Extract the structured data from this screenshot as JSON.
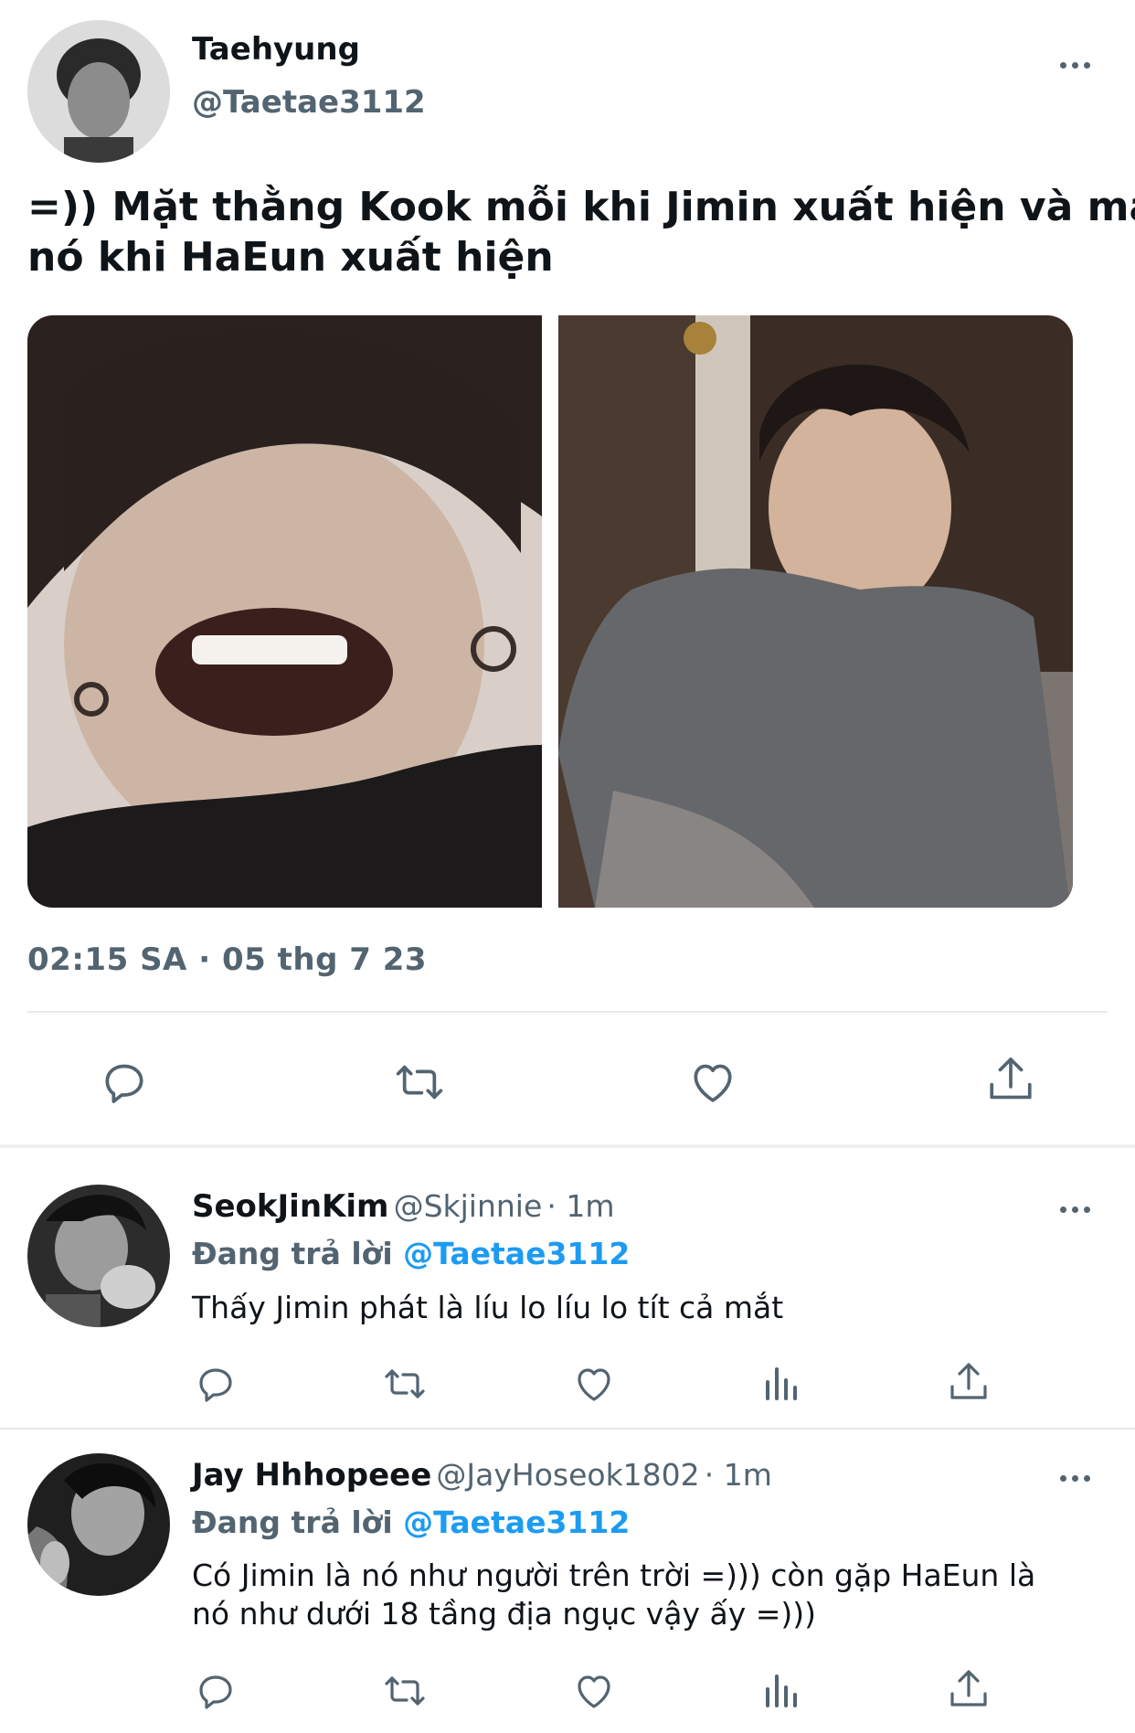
{
  "tweet": {
    "display_name": "Taehyung",
    "handle": "@Taetae3112",
    "text_line1": "=)) Mặt thằng Kook mỗi khi Jimin xuất hiện và mặt",
    "text_line2": "nó khi HaEun xuất hiện",
    "timestamp": "02:15 SA · 05 thg 7 23",
    "more_icon": "more-horizontal-icon"
  },
  "actions": [
    "reply-icon",
    "retweet-icon",
    "like-icon",
    "share-icon"
  ],
  "replies": [
    {
      "display_name": "SeokJinKim",
      "handle": "@Skjinnie",
      "time": "· 1m",
      "replying_to_label": "Đang trả lời",
      "replying_to_handle": "@Taetae3112",
      "text_line1": "Thấy Jimin phát là líu lo líu lo tít cả mắt",
      "text_line2": ""
    },
    {
      "display_name": "Jay Hhhopeee",
      "handle": "@JayHoseok1802",
      "time": "· 1m",
      "replying_to_label": "Đang trả lời",
      "replying_to_handle": "@Taetae3112",
      "text_line1": "Có Jimin là nó như người trên trời =))) còn gặp HaEun là",
      "text_line2": "nó như dưới 18 tầng địa ngục vậy ấy =)))"
    }
  ],
  "colors": {
    "text": "#0f1419",
    "secondary": "#536471",
    "mention": "#1d9bf0",
    "divider": "#e6e9eb"
  }
}
